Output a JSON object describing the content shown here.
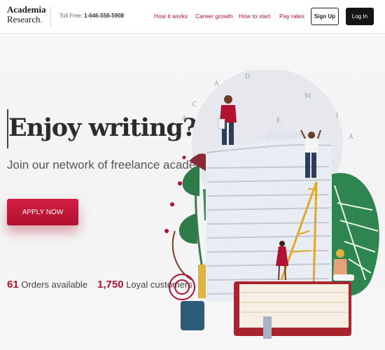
{
  "header": {
    "logo": {
      "line1": "Academia",
      "line2": "Research",
      "mark": "."
    },
    "phone": {
      "label": "Toll Free: ",
      "number": "1-646-558-5908"
    },
    "nav": [
      "How it works",
      "Career growth",
      "How to start",
      "Pay rates"
    ],
    "signup_label": "Sign Up",
    "login_label": "Log In"
  },
  "hero": {
    "headline": "Enjoy writing?",
    "subheadline": "Join our network of freelance academic writers",
    "cta_label": "APPLY NOW",
    "stats": [
      {
        "value": "61",
        "label": " Orders available"
      },
      {
        "value": "1,750",
        "label": " Loyal customers"
      }
    ]
  },
  "illustration": {
    "watermark_letters": [
      "A",
      "C",
      "A",
      "D",
      "E",
      "M",
      "I",
      "A"
    ],
    "colors": {
      "accent": "#b11233",
      "paper": "#eef0f5",
      "leaf": "#3e8f5a",
      "book": "#a9242e",
      "ladder": "#e0a92a"
    }
  }
}
